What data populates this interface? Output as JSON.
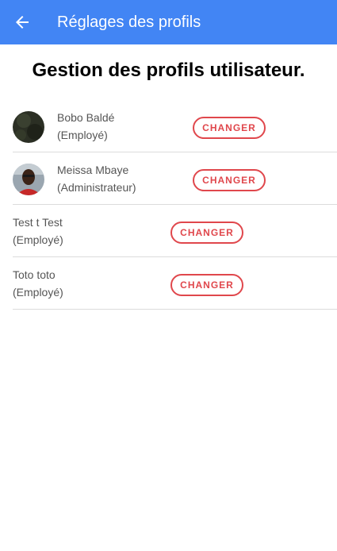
{
  "appbar": {
    "title": "Réglages des profils",
    "back_icon": "arrow-back-icon",
    "color": "#4285f4"
  },
  "heading": "Gestion des profils utilisateur.",
  "profiles": [
    {
      "name": "Bobo Baldé",
      "role": "(Employé)",
      "has_avatar": true,
      "button": "CHANGER"
    },
    {
      "name": "Meissa Mbaye",
      "role": "(Administrateur)",
      "has_avatar": true,
      "button": "CHANGER"
    },
    {
      "name": "Test t Test",
      "role": "(Employé)",
      "has_avatar": false,
      "button": "CHANGER"
    },
    {
      "name": "Toto toto",
      "role": "(Employé)",
      "has_avatar": false,
      "button": "CHANGER"
    }
  ],
  "colors": {
    "accent": "#4285f4",
    "button_outline": "#e0474c"
  }
}
